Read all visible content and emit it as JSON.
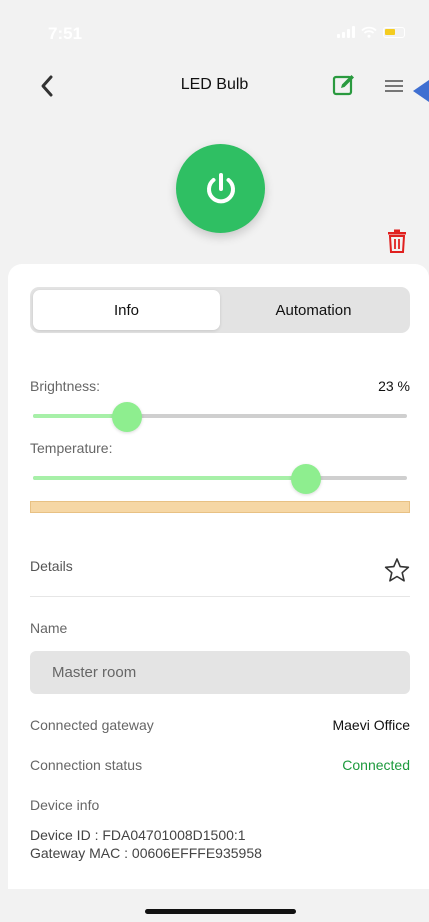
{
  "status_bar": {
    "time": "7:51"
  },
  "header": {
    "title": "LED Bulb"
  },
  "tabs": [
    {
      "label": "Info",
      "active": true
    },
    {
      "label": "Automation",
      "active": false
    }
  ],
  "controls": {
    "brightness_label": "Brightness:",
    "brightness_value": "23 %",
    "brightness_fraction": 0.25,
    "temperature_label": "Temperature:",
    "temperature_fraction": 0.73
  },
  "details": {
    "title": "Details",
    "name_label": "Name",
    "name_value": "Master room",
    "gateway_label": "Connected gateway",
    "gateway_value": "Maevi Office",
    "status_label": "Connection status",
    "status_value": "Connected",
    "device_info_label": "Device info",
    "device_id": "Device ID : FDA04701008D1500:1",
    "gateway_mac": "Gateway MAC : 00606EFFFE935958"
  },
  "colors": {
    "accent_green": "#2fbf63",
    "slider_green": "#8eee8f",
    "connected_text": "#1d9a3d",
    "delete_red": "#e0201f",
    "temperature_bar": "#f6d7a5"
  },
  "icons": {
    "back": "chevron-left-icon",
    "edit": "edit-icon",
    "menu": "hamburger-menu-icon",
    "power": "power-icon",
    "delete": "trash-icon",
    "favorite": "star-outline-icon"
  }
}
